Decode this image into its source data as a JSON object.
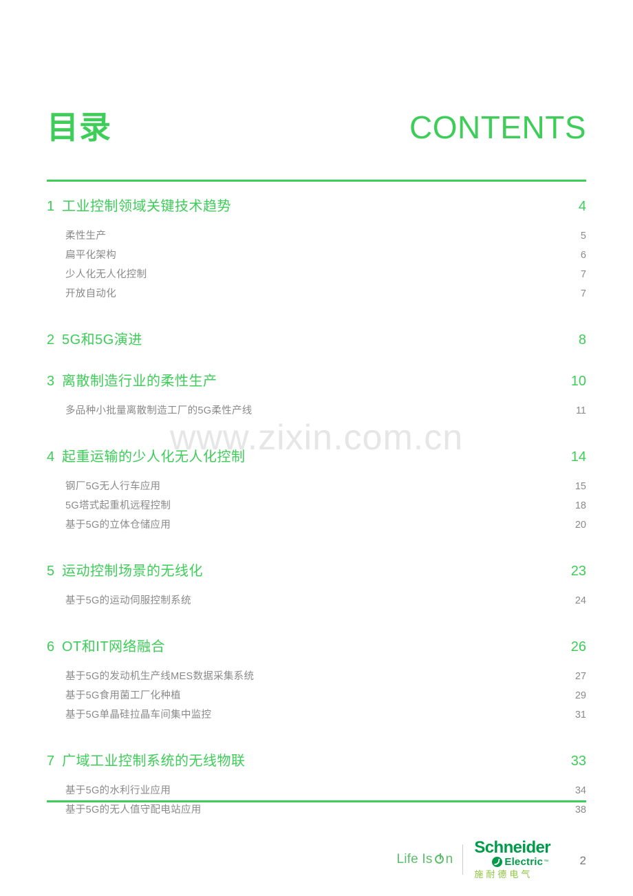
{
  "header": {
    "title_cn": "目录",
    "title_en": "CONTENTS"
  },
  "watermark": "www.zixin.com.cn",
  "accent_color": "#3dcd58",
  "subitem_color": "#8a8a8a",
  "toc": {
    "groups": [
      {
        "num": "1",
        "label": "工业控制领域关键技术趋势",
        "page": "4",
        "children": [
          {
            "label": "柔性生产",
            "page": "5"
          },
          {
            "label": "扁平化架构",
            "page": "6"
          },
          {
            "label": "少人化无人化控制",
            "page": "7"
          },
          {
            "label": "开放自动化",
            "page": "7"
          }
        ]
      },
      {
        "num": "2",
        "label": "5G和5G演进",
        "page": "8",
        "children": []
      },
      {
        "num": "3",
        "label": "离散制造行业的柔性生产",
        "page": "10",
        "children": [
          {
            "label": "多品种小批量离散制造工厂的5G柔性产线",
            "page": "11"
          }
        ]
      },
      {
        "num": "4",
        "label": "起重运输的少人化无人化控制",
        "page": "14",
        "children": [
          {
            "label": "钢厂5G无人行车应用",
            "page": "15"
          },
          {
            "label": "5G塔式起重机远程控制",
            "page": "18"
          },
          {
            "label": "基于5G的立体仓储应用",
            "page": "20"
          }
        ]
      },
      {
        "num": "5",
        "label": "运动控制场景的无线化",
        "page": "23",
        "children": [
          {
            "label": "基于5G的运动伺服控制系统",
            "page": "24"
          }
        ]
      },
      {
        "num": "6",
        "label": "OT和IT网络融合",
        "page": "26",
        "children": [
          {
            "label": "基于5G的发动机生产线MES数据采集系统",
            "page": "27"
          },
          {
            "label": "基于5G食用菌工厂化种植",
            "page": "29"
          },
          {
            "label": "基于5G单晶硅拉晶车间集中监控",
            "page": "31"
          }
        ]
      },
      {
        "num": "7",
        "label": "广域工业控制系统的无线物联",
        "page": "33",
        "children": [
          {
            "label": "基于5G的水利行业应用",
            "page": "34"
          },
          {
            "label": "基于5G的无人值守配电站应用",
            "page": "38"
          }
        ]
      }
    ]
  },
  "footer": {
    "tagline_pre": "Life Is",
    "tagline_post": "n",
    "brand_top": "Schneider",
    "brand_bottom": "Electric",
    "brand_tm": "™",
    "brand_cn": "施耐德电气",
    "folio": "2"
  }
}
